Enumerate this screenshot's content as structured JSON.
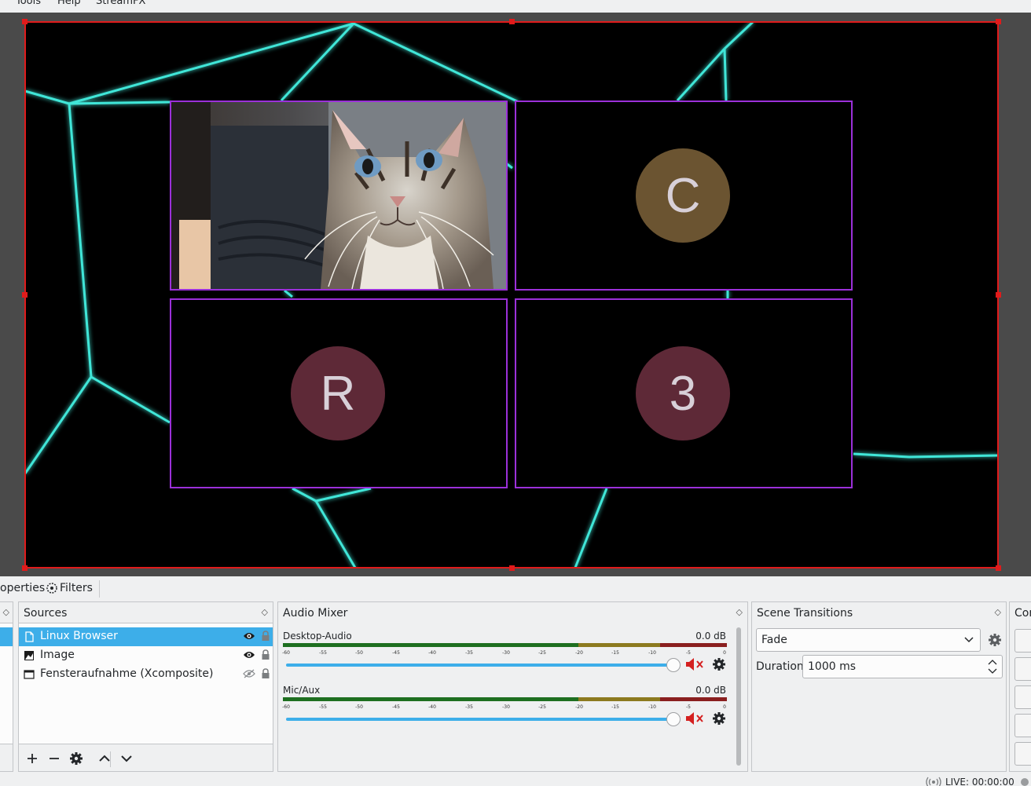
{
  "menu": {
    "items": [
      "Tools",
      "Help",
      "StreamFX"
    ]
  },
  "preview": {
    "tiles": [
      {
        "type": "webcam",
        "name": "cat-webcam"
      },
      {
        "type": "avatar",
        "letter": "C",
        "color": "#6b5431"
      },
      {
        "type": "avatar",
        "letter": "R",
        "color": "#5e2937"
      },
      {
        "type": "avatar",
        "letter": "3",
        "color": "#5e2937"
      }
    ]
  },
  "toolbar": {
    "properties_label": "operties",
    "filters_label": "Filters"
  },
  "sources": {
    "title": "Sources",
    "items": [
      {
        "label": "Linux Browser",
        "icon": "browser-icon",
        "visible": true,
        "selected": true
      },
      {
        "label": "Image",
        "icon": "image-icon",
        "visible": true,
        "selected": false
      },
      {
        "label": "Fensteraufnahme (Xcomposite)",
        "icon": "window-capture-icon",
        "visible": false,
        "selected": false
      }
    ]
  },
  "mixer": {
    "title": "Audio Mixer",
    "scale": [
      "-60",
      "-55",
      "-50",
      "-45",
      "-40",
      "-35",
      "-30",
      "-25",
      "-20",
      "-15",
      "-10",
      "-5",
      "0"
    ],
    "channels": [
      {
        "name": "Desktop-Audio",
        "db": "0.0 dB",
        "volume": 1.0,
        "muted": true
      },
      {
        "name": "Mic/Aux",
        "db": "0.0 dB",
        "volume": 1.0,
        "muted": true
      }
    ]
  },
  "transitions": {
    "title": "Scene Transitions",
    "selected": "Fade",
    "duration_label": "Duration",
    "duration_value": "1000 ms"
  },
  "controls": {
    "title": "Con"
  },
  "status": {
    "live": "LIVE: 00:00:00"
  }
}
